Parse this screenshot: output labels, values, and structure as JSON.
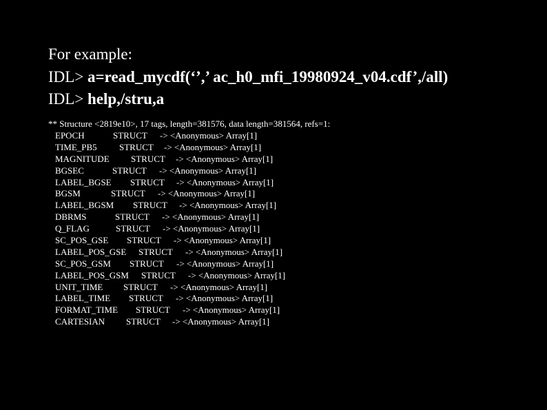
{
  "intro": "For example:",
  "prompt": "IDL> ",
  "commands": [
    "a=read_mycdf(‘’,’ ac_h0_mfi_19980924_v04.cdf’,/all)",
    "help,/stru,a"
  ],
  "structure_header": "** Structure <2819e10>, 17 tags, length=381576, data length=381564, refs=1:",
  "tags": [
    {
      "name": "EPOCH",
      "type": "STRUCT",
      "value": "-> <Anonymous> Array[1]"
    },
    {
      "name": "TIME_PB5",
      "type": "STRUCT",
      "value": "-> <Anonymous> Array[1]"
    },
    {
      "name": "MAGNITUDE",
      "type": "STRUCT",
      "value": "-> <Anonymous> Array[1]"
    },
    {
      "name": "BGSEC",
      "type": "STRUCT",
      "value": "-> <Anonymous> Array[1]"
    },
    {
      "name": "LABEL_BGSE",
      "type": "STRUCT",
      "value": "-> <Anonymous> Array[1]"
    },
    {
      "name": "BGSM",
      "type": "STRUCT",
      "value": "-> <Anonymous> Array[1]"
    },
    {
      "name": "LABEL_BGSM",
      "type": "STRUCT",
      "value": "-> <Anonymous> Array[1]"
    },
    {
      "name": "DBRMS",
      "type": "STRUCT",
      "value": "-> <Anonymous> Array[1]"
    },
    {
      "name": "Q_FLAG",
      "type": "STRUCT",
      "value": "-> <Anonymous> Array[1]"
    },
    {
      "name": "SC_POS_GSE",
      "type": "STRUCT",
      "value": "-> <Anonymous> Array[1]"
    },
    {
      "name": "LABEL_POS_GSE",
      "type": "STRUCT",
      "value": "-> <Anonymous> Array[1]"
    },
    {
      "name": "SC_POS_GSM",
      "type": "STRUCT",
      "value": "-> <Anonymous> Array[1]"
    },
    {
      "name": "LABEL_POS_GSM",
      "type": "STRUCT",
      "value": "-> <Anonymous> Array[1]"
    },
    {
      "name": "UNIT_TIME",
      "type": "STRUCT",
      "value": "-> <Anonymous> Array[1]"
    },
    {
      "name": "LABEL_TIME",
      "type": "STRUCT",
      "value": "-> <Anonymous> Array[1]"
    },
    {
      "name": "FORMAT_TIME",
      "type": "STRUCT",
      "value": "-> <Anonymous> Array[1]"
    },
    {
      "name": "CARTESIAN",
      "type": "STRUCT",
      "value": "-> <Anonymous> Array[1]"
    }
  ]
}
